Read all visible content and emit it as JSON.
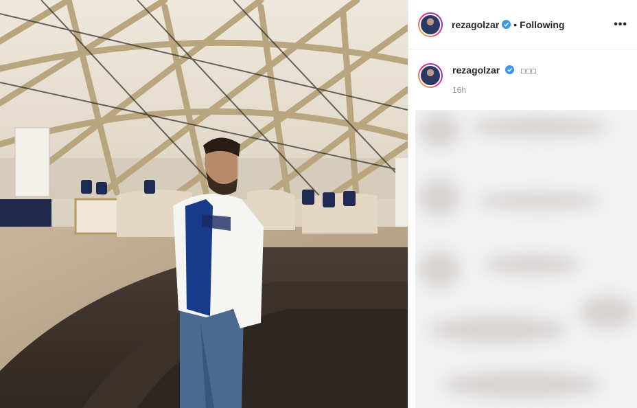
{
  "post": {
    "username": "rezagolzar",
    "follow_separator": "•",
    "follow_status": "Following",
    "more_label": "•••",
    "caption_text": "□□□",
    "timestamp": "16h"
  },
  "colors": {
    "verified_badge": "#3897f0",
    "text_primary": "#262626",
    "text_secondary": "#8e8e8e",
    "divider": "#efefef"
  },
  "icons": {
    "verified": "verified-badge-icon",
    "more": "more-options-icon"
  }
}
